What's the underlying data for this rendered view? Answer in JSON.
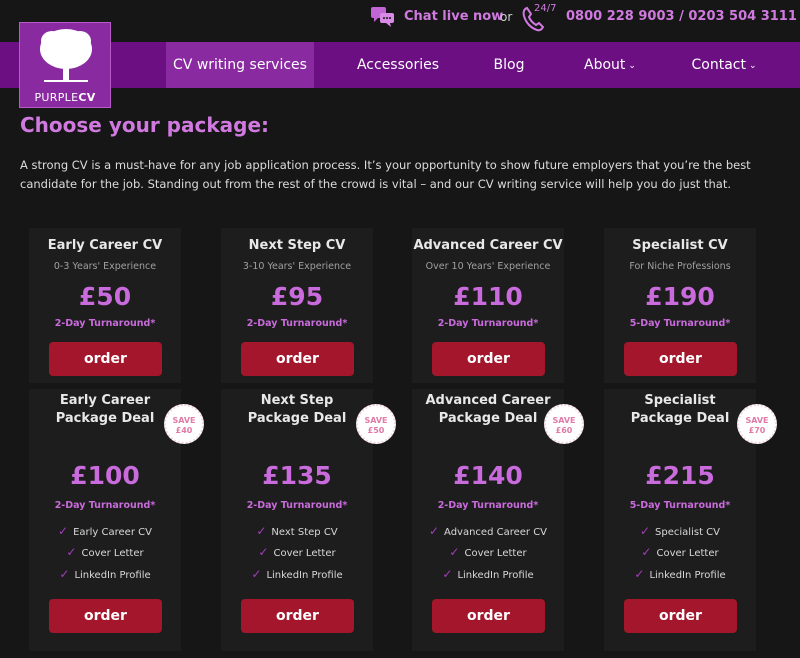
{
  "topbar": {
    "chat_label": "Chat live now",
    "or_label": "or",
    "badge_247": "24/7",
    "phones": "0800 228 9003 / 0203 504 3111"
  },
  "logo": {
    "text_a": "PURPLE",
    "text_b": "CV"
  },
  "nav": {
    "items": [
      {
        "label": "CV writing services"
      },
      {
        "label": "Accessories"
      },
      {
        "label": "Blog"
      },
      {
        "label": "About"
      },
      {
        "label": "Contact"
      }
    ]
  },
  "main": {
    "title": "Choose your package:",
    "intro": "A strong CV is a must-have for any job application process. It’s your opportunity to show future employers that you’re the best candidate for the job. Standing out from the rest of the crowd is vital – and our CV writing service will help you do just that."
  },
  "packages": [
    {
      "title": "Early Career CV",
      "sub": "0-3 Years' Experience",
      "price": "£50",
      "turn": "2-Day Turnaround*",
      "order": "order"
    },
    {
      "title": "Next Step CV",
      "sub": "3-10 Years' Experience",
      "price": "£95",
      "turn": "2-Day Turnaround*",
      "order": "order"
    },
    {
      "title": "Advanced Career CV",
      "sub": "Over 10 Years' Experience",
      "price": "£110",
      "turn": "2-Day Turnaround*",
      "order": "order"
    },
    {
      "title": "Specialist CV",
      "sub": "For Niche Professions",
      "price": "£190",
      "turn": "5-Day Turnaround*",
      "order": "order"
    }
  ],
  "deals": [
    {
      "title1": "Early Career",
      "title2": "Package Deal",
      "save1": "SAVE",
      "save2": "£40",
      "price": "£100",
      "turn": "2-Day Turnaround*",
      "features": [
        "Early Career CV",
        "Cover Letter",
        "LinkedIn Profile"
      ],
      "order": "order"
    },
    {
      "title1": "Next Step",
      "title2": "Package Deal",
      "save1": "SAVE",
      "save2": "£50",
      "price": "£135",
      "turn": "2-Day Turnaround*",
      "features": [
        "Next Step CV",
        "Cover Letter",
        "LinkedIn Profile"
      ],
      "order": "order"
    },
    {
      "title1": "Advanced Career",
      "title2": "Package Deal",
      "save1": "SAVE",
      "save2": "£60",
      "price": "£140",
      "turn": "2-Day Turnaround*",
      "features": [
        "Advanced Career CV",
        "Cover Letter",
        "LinkedIn Profile"
      ],
      "order": "order"
    },
    {
      "title1": "Specialist",
      "title2": "Package Deal",
      "save1": "SAVE",
      "save2": "£70",
      "price": "£215",
      "turn": "5-Day Turnaround*",
      "features": [
        "Specialist CV",
        "Cover Letter",
        "LinkedIn Profile"
      ],
      "order": "order"
    }
  ],
  "colors": {
    "accent": "#d07ae0",
    "nav": "#6b0f83",
    "button": "#a3162c"
  },
  "icons": {
    "chat": "chat-bubbles-icon",
    "phone": "phone-icon",
    "check": "check-icon",
    "chevron": "chevron-down-icon"
  }
}
